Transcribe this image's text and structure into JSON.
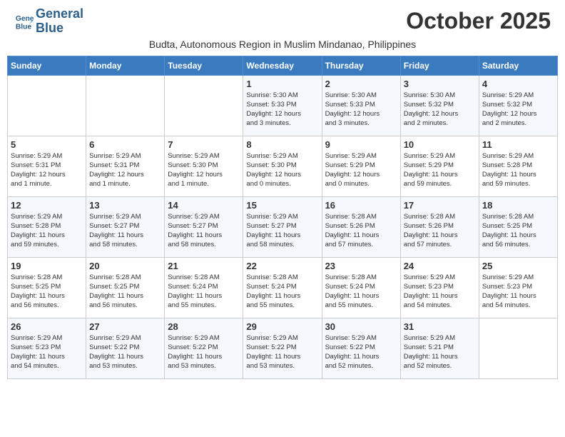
{
  "header": {
    "logo_line1": "General",
    "logo_line2": "Blue",
    "month_title": "October 2025",
    "subtitle": "Budta, Autonomous Region in Muslim Mindanao, Philippines"
  },
  "weekdays": [
    "Sunday",
    "Monday",
    "Tuesday",
    "Wednesday",
    "Thursday",
    "Friday",
    "Saturday"
  ],
  "weeks": [
    [
      {
        "day": "",
        "info": ""
      },
      {
        "day": "",
        "info": ""
      },
      {
        "day": "",
        "info": ""
      },
      {
        "day": "1",
        "info": "Sunrise: 5:30 AM\nSunset: 5:33 PM\nDaylight: 12 hours\nand 3 minutes."
      },
      {
        "day": "2",
        "info": "Sunrise: 5:30 AM\nSunset: 5:33 PM\nDaylight: 12 hours\nand 3 minutes."
      },
      {
        "day": "3",
        "info": "Sunrise: 5:30 AM\nSunset: 5:32 PM\nDaylight: 12 hours\nand 2 minutes."
      },
      {
        "day": "4",
        "info": "Sunrise: 5:29 AM\nSunset: 5:32 PM\nDaylight: 12 hours\nand 2 minutes."
      }
    ],
    [
      {
        "day": "5",
        "info": "Sunrise: 5:29 AM\nSunset: 5:31 PM\nDaylight: 12 hours\nand 1 minute."
      },
      {
        "day": "6",
        "info": "Sunrise: 5:29 AM\nSunset: 5:31 PM\nDaylight: 12 hours\nand 1 minute."
      },
      {
        "day": "7",
        "info": "Sunrise: 5:29 AM\nSunset: 5:30 PM\nDaylight: 12 hours\nand 1 minute."
      },
      {
        "day": "8",
        "info": "Sunrise: 5:29 AM\nSunset: 5:30 PM\nDaylight: 12 hours\nand 0 minutes."
      },
      {
        "day": "9",
        "info": "Sunrise: 5:29 AM\nSunset: 5:29 PM\nDaylight: 12 hours\nand 0 minutes."
      },
      {
        "day": "10",
        "info": "Sunrise: 5:29 AM\nSunset: 5:29 PM\nDaylight: 11 hours\nand 59 minutes."
      },
      {
        "day": "11",
        "info": "Sunrise: 5:29 AM\nSunset: 5:28 PM\nDaylight: 11 hours\nand 59 minutes."
      }
    ],
    [
      {
        "day": "12",
        "info": "Sunrise: 5:29 AM\nSunset: 5:28 PM\nDaylight: 11 hours\nand 59 minutes."
      },
      {
        "day": "13",
        "info": "Sunrise: 5:29 AM\nSunset: 5:27 PM\nDaylight: 11 hours\nand 58 minutes."
      },
      {
        "day": "14",
        "info": "Sunrise: 5:29 AM\nSunset: 5:27 PM\nDaylight: 11 hours\nand 58 minutes."
      },
      {
        "day": "15",
        "info": "Sunrise: 5:29 AM\nSunset: 5:27 PM\nDaylight: 11 hours\nand 58 minutes."
      },
      {
        "day": "16",
        "info": "Sunrise: 5:28 AM\nSunset: 5:26 PM\nDaylight: 11 hours\nand 57 minutes."
      },
      {
        "day": "17",
        "info": "Sunrise: 5:28 AM\nSunset: 5:26 PM\nDaylight: 11 hours\nand 57 minutes."
      },
      {
        "day": "18",
        "info": "Sunrise: 5:28 AM\nSunset: 5:25 PM\nDaylight: 11 hours\nand 56 minutes."
      }
    ],
    [
      {
        "day": "19",
        "info": "Sunrise: 5:28 AM\nSunset: 5:25 PM\nDaylight: 11 hours\nand 56 minutes."
      },
      {
        "day": "20",
        "info": "Sunrise: 5:28 AM\nSunset: 5:25 PM\nDaylight: 11 hours\nand 56 minutes."
      },
      {
        "day": "21",
        "info": "Sunrise: 5:28 AM\nSunset: 5:24 PM\nDaylight: 11 hours\nand 55 minutes."
      },
      {
        "day": "22",
        "info": "Sunrise: 5:28 AM\nSunset: 5:24 PM\nDaylight: 11 hours\nand 55 minutes."
      },
      {
        "day": "23",
        "info": "Sunrise: 5:28 AM\nSunset: 5:24 PM\nDaylight: 11 hours\nand 55 minutes."
      },
      {
        "day": "24",
        "info": "Sunrise: 5:29 AM\nSunset: 5:23 PM\nDaylight: 11 hours\nand 54 minutes."
      },
      {
        "day": "25",
        "info": "Sunrise: 5:29 AM\nSunset: 5:23 PM\nDaylight: 11 hours\nand 54 minutes."
      }
    ],
    [
      {
        "day": "26",
        "info": "Sunrise: 5:29 AM\nSunset: 5:23 PM\nDaylight: 11 hours\nand 54 minutes."
      },
      {
        "day": "27",
        "info": "Sunrise: 5:29 AM\nSunset: 5:22 PM\nDaylight: 11 hours\nand 53 minutes."
      },
      {
        "day": "28",
        "info": "Sunrise: 5:29 AM\nSunset: 5:22 PM\nDaylight: 11 hours\nand 53 minutes."
      },
      {
        "day": "29",
        "info": "Sunrise: 5:29 AM\nSunset: 5:22 PM\nDaylight: 11 hours\nand 53 minutes."
      },
      {
        "day": "30",
        "info": "Sunrise: 5:29 AM\nSunset: 5:22 PM\nDaylight: 11 hours\nand 52 minutes."
      },
      {
        "day": "31",
        "info": "Sunrise: 5:29 AM\nSunset: 5:21 PM\nDaylight: 11 hours\nand 52 minutes."
      },
      {
        "day": "",
        "info": ""
      }
    ]
  ]
}
